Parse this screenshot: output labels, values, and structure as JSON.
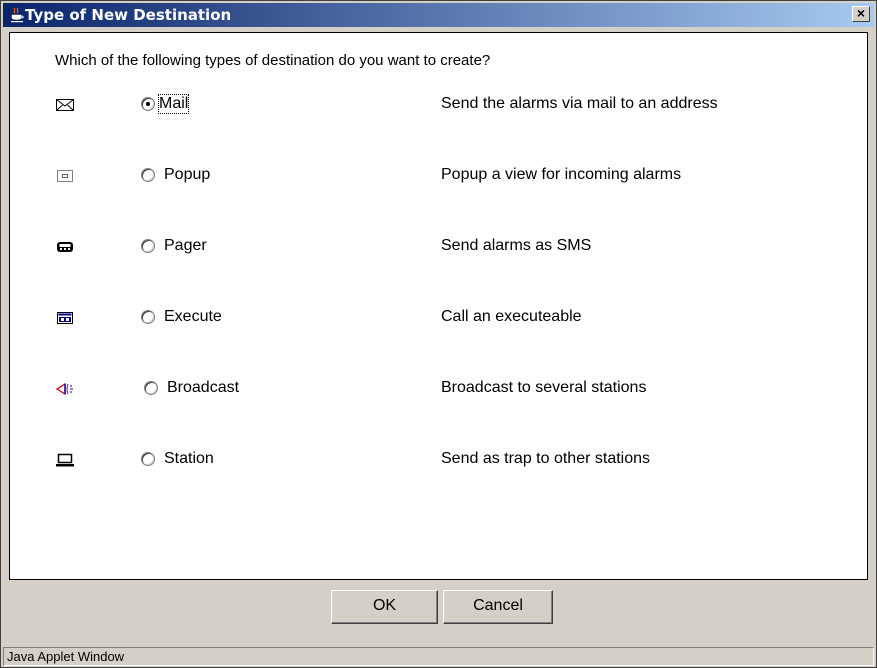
{
  "window": {
    "title": "Type of New Destination",
    "close_label": "×"
  },
  "question": "Which of the following types of destination do you want to create?",
  "options": [
    {
      "label": "Mail",
      "description": "Send the alarms via mail to an address",
      "selected": true,
      "icon": "envelope-icon"
    },
    {
      "label": "Popup",
      "description": "Popup a view for incoming alarms",
      "selected": false,
      "icon": "popup-window-icon"
    },
    {
      "label": "Pager",
      "description": "Send alarms as SMS",
      "selected": false,
      "icon": "pager-icon"
    },
    {
      "label": "Execute",
      "description": "Call an executeable",
      "selected": false,
      "icon": "executable-icon"
    },
    {
      "label": "Broadcast",
      "description": "Broadcast to several stations",
      "selected": false,
      "icon": "broadcast-icon"
    },
    {
      "label": "Station",
      "description": "Send as trap to other stations",
      "selected": false,
      "icon": "station-icon"
    }
  ],
  "buttons": {
    "ok": "OK",
    "cancel": "Cancel"
  },
  "status": "Java Applet Window"
}
